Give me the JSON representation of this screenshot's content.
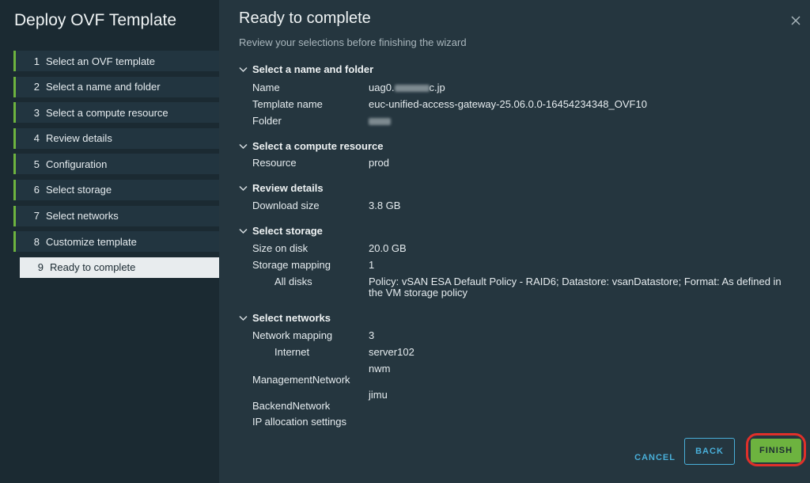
{
  "wizard": {
    "title": "Deploy OVF Template"
  },
  "steps": [
    {
      "num": "1",
      "label": "Select an OVF template"
    },
    {
      "num": "2",
      "label": "Select a name and folder"
    },
    {
      "num": "3",
      "label": "Select a compute resource"
    },
    {
      "num": "4",
      "label": "Review details"
    },
    {
      "num": "5",
      "label": "Configuration"
    },
    {
      "num": "6",
      "label": "Select storage"
    },
    {
      "num": "7",
      "label": "Select networks"
    },
    {
      "num": "8",
      "label": "Customize template"
    },
    {
      "num": "9",
      "label": "Ready to complete"
    }
  ],
  "page": {
    "title": "Ready to complete",
    "subtitle": "Review your selections before finishing the wizard"
  },
  "sections": {
    "name_folder": {
      "title": "Select a name and folder",
      "name_k": "Name",
      "name_v_pre": "uag0.",
      "name_v_post": "c.jp",
      "template_k": "Template name",
      "template_v": "euc-unified-access-gateway-25.06.0.0-16454234348_OVF10",
      "folder_k": "Folder"
    },
    "compute": {
      "title": "Select a compute resource",
      "resource_k": "Resource",
      "resource_v": "prod"
    },
    "review": {
      "title": "Review details",
      "download_k": "Download size",
      "download_v": "3.8 GB"
    },
    "storage": {
      "title": "Select storage",
      "size_k": "Size on disk",
      "size_v": "20.0 GB",
      "mapping_k": "Storage mapping",
      "mapping_v": "1",
      "alldisks_k": "All disks",
      "alldisks_v": "Policy: vSAN ESA Default Policy - RAID6; Datastore: vsanDatastore; Format: As defined in the VM storage policy"
    },
    "networks": {
      "title": "Select networks",
      "mapping_k": "Network mapping",
      "mapping_v": "3",
      "internet_k": "Internet",
      "internet_v": "server102",
      "mgmt_v": "nwm",
      "mgmt_k": "ManagementNetwork",
      "backend_v": "jimu",
      "backend_k": "BackendNetwork",
      "ip_k": "IP allocation settings"
    }
  },
  "footer": {
    "cancel": "CANCEL",
    "back": "BACK",
    "finish": "FINISH"
  },
  "colors": {
    "accent_green": "#6db33f",
    "link_blue": "#49afd9",
    "highlight_red": "#e0302a"
  }
}
